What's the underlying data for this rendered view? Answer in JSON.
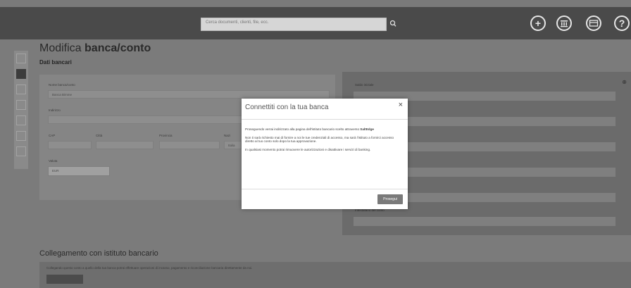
{
  "header": {
    "search_placeholder": "Cerca documenti, clienti, file, ecc.",
    "icons": [
      "plus-icon",
      "bank-icon",
      "card-icon",
      "help-icon"
    ]
  },
  "page": {
    "title_light": "Modifica ",
    "title_bold": "banca/conto",
    "subtitle": "Dati bancari"
  },
  "form": {
    "bank_name_label": "Nome banca/conto",
    "bank_name_value": "Banca Bimme",
    "address_label": "Indirizzo",
    "cap_label": "CAP",
    "city_label": "Città",
    "province_label": "Provincia",
    "nation_label": "Nazione",
    "nation_value": "Italia",
    "currency_label": "Valuta",
    "currency_value": "EUR",
    "partial_label": "Nazi"
  },
  "right_panel": {
    "owner_label": "Intestatario del conto",
    "top_label": "Saldo iniziale"
  },
  "section": {
    "title": "Collegamento con istituto bancario",
    "text": "Collegando questo conto a quello della tua banca potrai effettuare operazioni di incasso, pagamento e riconciliazione bancaria direttamente da noi."
  },
  "modal": {
    "title": "Connettiti con la tua banca",
    "close": "×",
    "p1_a": "Proseguendo verrai indirizzato alla pagina dell'istituto bancario scelto attraverso ",
    "p1_bold": "SaltEdge",
    "p2": "Non ti sarà richiesto mai di fornire a noi le tue credenziali di accesso, ma sarà l'istituto a fornirci accesso diretto al tuo conto solo dopo la tua approvazione.",
    "p3": "In qualsiasi momento potrai rimuovere le autorizzazioni e disattivare i servizi di banking.",
    "button": "Prosegui"
  },
  "colors": {
    "overlay": "#7a7a7a",
    "modal_bg": "#ffffff",
    "topbar": "#4a4a4a"
  }
}
